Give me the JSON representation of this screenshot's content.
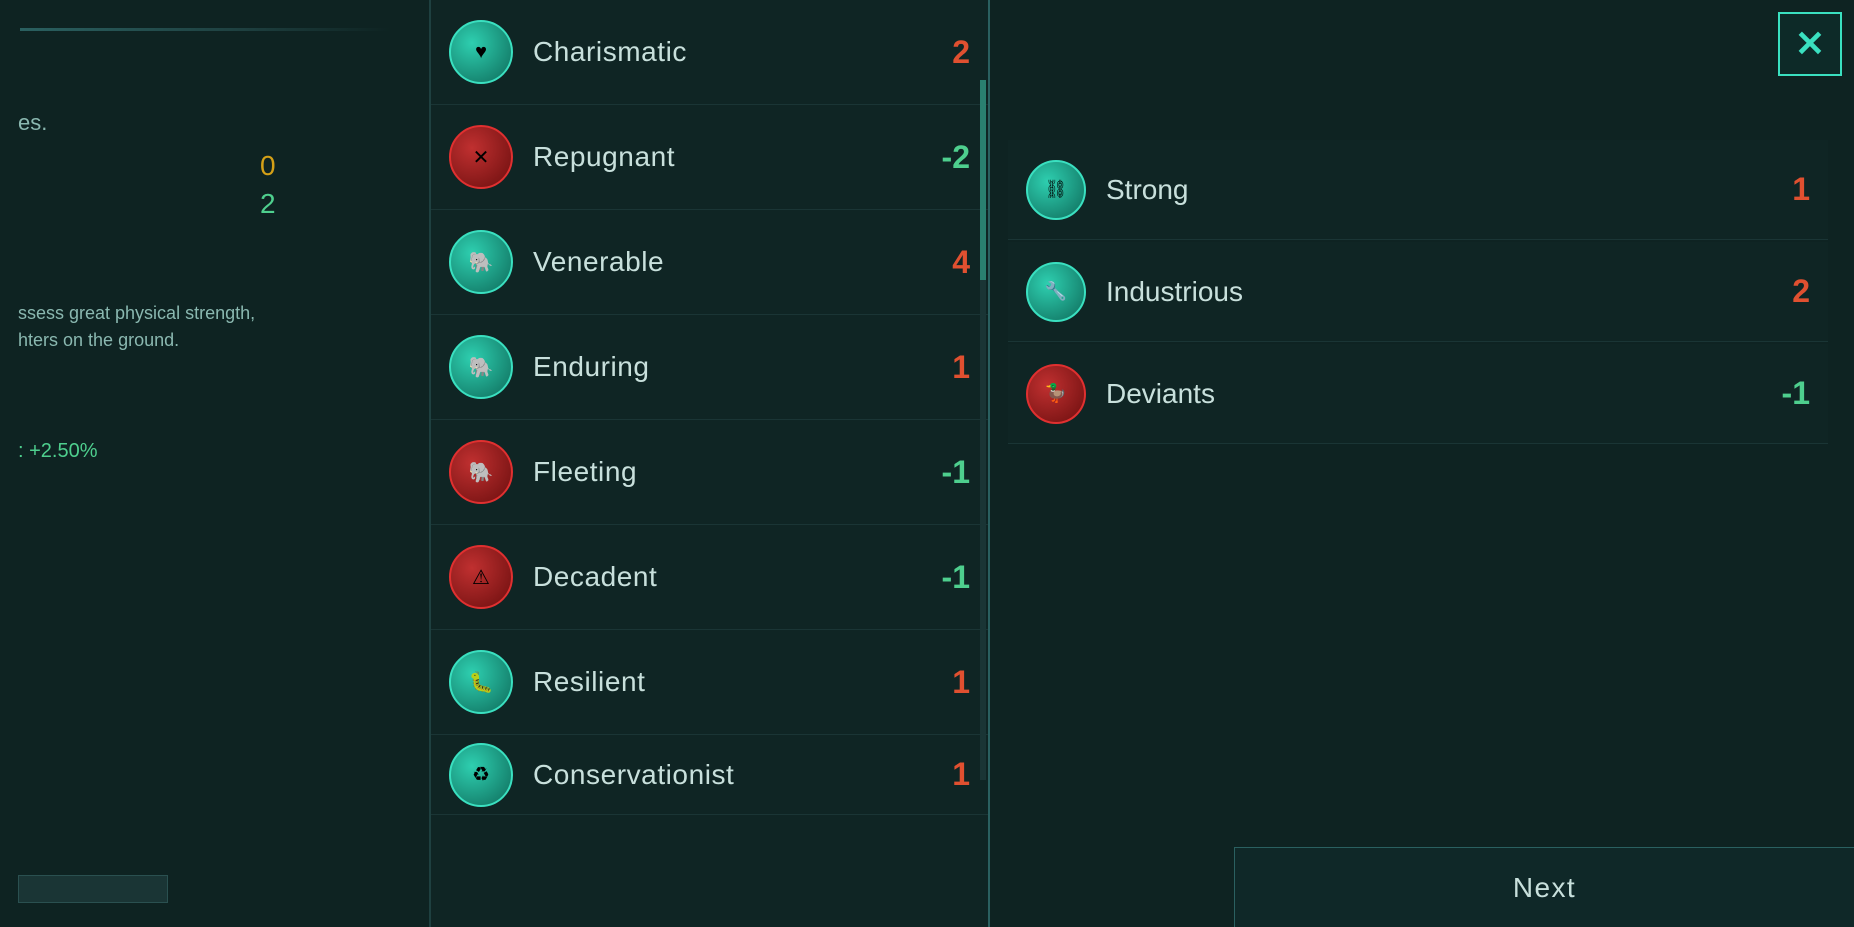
{
  "left_panel": {
    "stat_zero": "0",
    "stat_two": "2",
    "description_line1": "ssess great physical strength,",
    "description_line2": "hters on the ground.",
    "bonus": ": +2.50%"
  },
  "traits": [
    {
      "name": "Charismatic",
      "value": "2",
      "positive": true,
      "icon_type": "teal",
      "icon_symbol": "♥"
    },
    {
      "name": "Repugnant",
      "value": "-2",
      "positive": false,
      "icon_type": "red",
      "icon_symbol": "✕"
    },
    {
      "name": "Venerable",
      "value": "4",
      "positive": true,
      "icon_type": "teal",
      "icon_symbol": "🐘"
    },
    {
      "name": "Enduring",
      "value": "1",
      "positive": true,
      "icon_type": "teal",
      "icon_symbol": "🐘"
    },
    {
      "name": "Fleeting",
      "value": "-1",
      "positive": false,
      "icon_type": "red",
      "icon_symbol": "🐘"
    },
    {
      "name": "Decadent",
      "value": "-1",
      "positive": false,
      "icon_type": "red",
      "icon_symbol": "⚠"
    },
    {
      "name": "Resilient",
      "value": "1",
      "positive": true,
      "icon_type": "teal",
      "icon_symbol": "🐛"
    },
    {
      "name": "Conservationist",
      "value": "1",
      "positive": true,
      "icon_type": "teal",
      "icon_symbol": "♻",
      "partial": true
    }
  ],
  "selected_traits": [
    {
      "name": "Strong",
      "value": "1",
      "positive": true,
      "icon_type": "teal",
      "icon_symbol": "⛓"
    },
    {
      "name": "Industrious",
      "value": "2",
      "positive": true,
      "icon_type": "teal",
      "icon_symbol": "🔧"
    },
    {
      "name": "Deviants",
      "value": "-1",
      "positive": false,
      "icon_type": "red",
      "icon_symbol": "🦆"
    }
  ],
  "buttons": {
    "close": "✕",
    "next": "Next"
  }
}
